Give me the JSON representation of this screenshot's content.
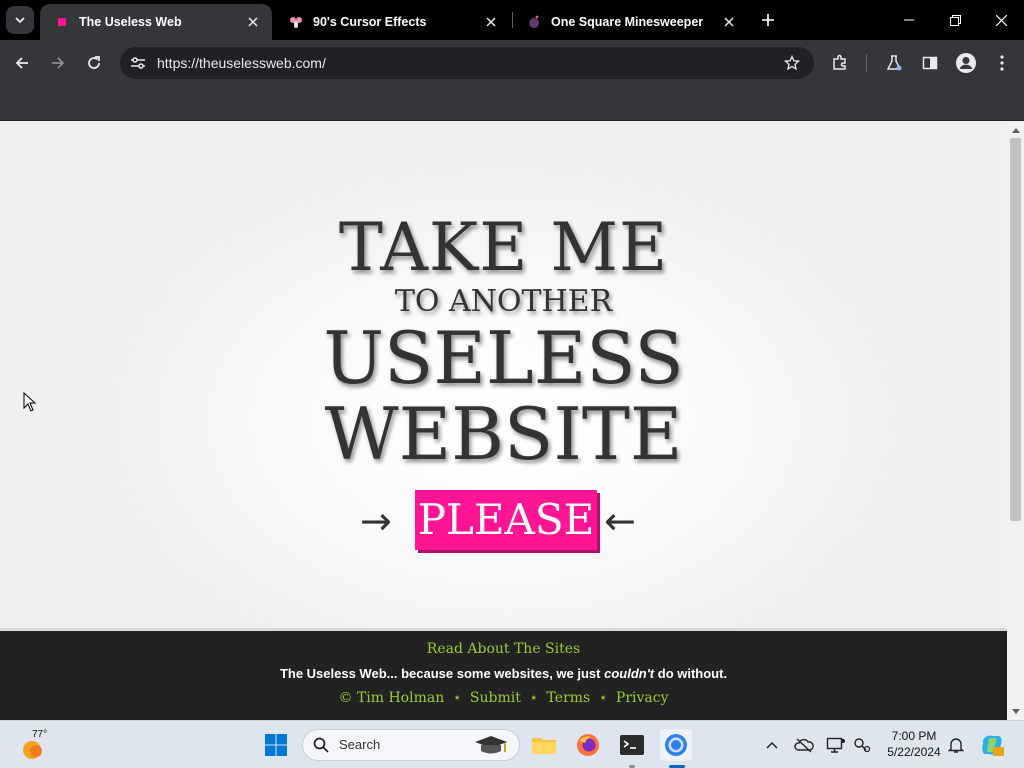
{
  "tabs": [
    {
      "title": "The Useless Web",
      "active": true,
      "favicon": "useless-web-favicon"
    },
    {
      "title": "90's Cursor Effects",
      "active": false,
      "favicon": "cursor-effects-favicon"
    },
    {
      "title": "One Square Minesweeper",
      "active": false,
      "favicon": "minesweeper-favicon"
    }
  ],
  "omnibox": {
    "url": "https://theuselessweb.com/"
  },
  "hero": {
    "line1": "TAKE ME",
    "line2": "TO ANOTHER",
    "line3": "USELESS",
    "line4": "WEBSITE",
    "arrow_left": "→",
    "arrow_right": "←",
    "button": "PLEASE"
  },
  "footer": {
    "title": "Read About The Sites",
    "tagline_start": "The Useless Web... because some websites, we just ",
    "tagline_em": "couldn't",
    "tagline_end": " do without.",
    "copyright": "© Tim Holman",
    "star": "⋆",
    "submit": "Submit",
    "terms": "Terms",
    "privacy": "Privacy"
  },
  "taskbar": {
    "weather_temp": "77°",
    "search_label": "Search",
    "time": "7:00 PM",
    "date": "5/22/2024"
  },
  "colors": {
    "accent_pink": "#ff1493",
    "footer_link_green": "#9acd32",
    "browser_frame": "#35363a"
  }
}
